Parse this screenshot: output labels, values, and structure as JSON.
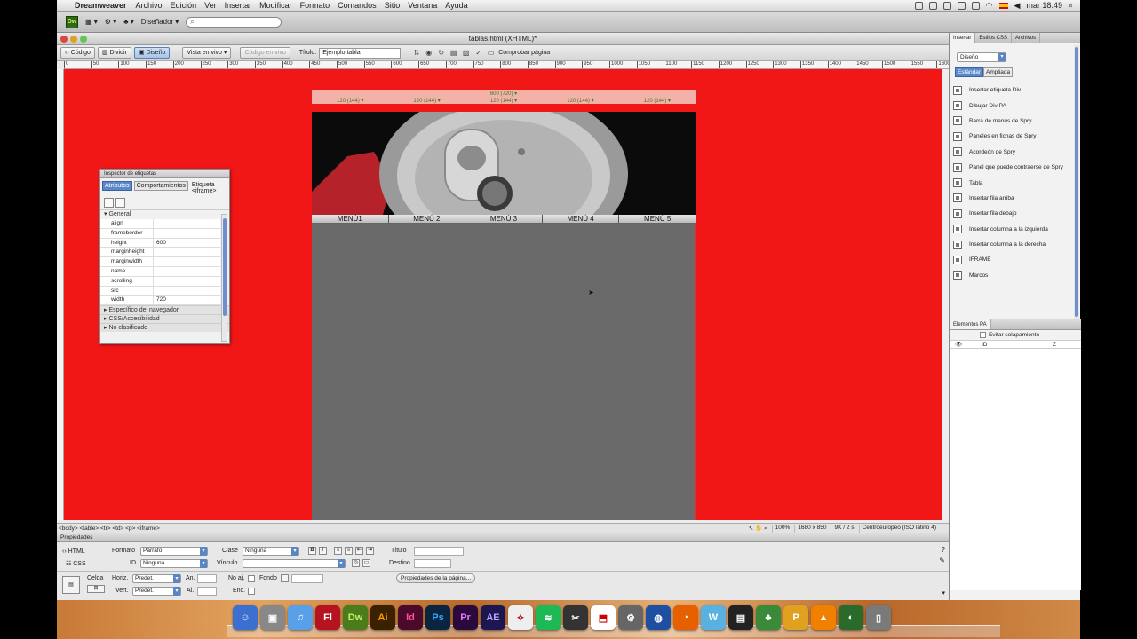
{
  "menubar": {
    "app": "Dreamweaver",
    "items": [
      "Archivo",
      "Edición",
      "Ver",
      "Insertar",
      "Modificar",
      "Formato",
      "Comandos",
      "Sitio",
      "Ventana",
      "Ayuda"
    ],
    "clock": "mar 18:49"
  },
  "appbar": {
    "logo": "Dw",
    "workspace": "Diseñador"
  },
  "document": {
    "window_title": "tablas.html (XHTML)*",
    "view_buttons": [
      "Código",
      "Dividir",
      "Diseño"
    ],
    "live_view": "Vista en vivo",
    "live_code": "Código en vivo",
    "title_label": "Título:",
    "title_value": "Ejemplo tabla",
    "check_page": "Comprobar página"
  },
  "ruler": {
    "ticks": [
      "0",
      "50",
      "100",
      "150",
      "200",
      "250",
      "300",
      "350",
      "400",
      "450",
      "500",
      "550",
      "600",
      "650",
      "700",
      "750",
      "800",
      "850",
      "900",
      "950",
      "1000",
      "1050",
      "1100",
      "1150",
      "1200",
      "1250",
      "1300",
      "1350",
      "1400",
      "1450",
      "1500",
      "1550",
      "1600"
    ]
  },
  "page": {
    "canvas_color": "#f11717",
    "table_width_label": "600 (720) ▾",
    "column_labels": [
      "120 (144) ▾",
      "120 (144) ▾",
      "120 (144) ▾",
      "120 (144) ▾",
      "120 (144) ▾"
    ],
    "menu": [
      "MENÚ1",
      "MENÚ 2",
      "MENÚ 3",
      "MENÚ 4",
      "MENÚ 5"
    ]
  },
  "inspector": {
    "title": "Inspector de etiquetas",
    "tabs": [
      "Atributos",
      "Comportamientos",
      "Etiqueta <iframe>"
    ],
    "section_general": "General",
    "attributes": [
      {
        "k": "align",
        "v": ""
      },
      {
        "k": "frameborder",
        "v": ""
      },
      {
        "k": "height",
        "v": "600"
      },
      {
        "k": "marginheight",
        "v": ""
      },
      {
        "k": "marginwidth",
        "v": ""
      },
      {
        "k": "name",
        "v": ""
      },
      {
        "k": "scrolling",
        "v": ""
      },
      {
        "k": "src",
        "v": ""
      },
      {
        "k": "width",
        "v": "720"
      }
    ],
    "collapsed": [
      "Específico del navegador",
      "CSS/Accesibilidad",
      "No clasificado"
    ]
  },
  "statusbar": {
    "tags": "<body> <table> <tr> <td> <p> <iframe>",
    "zoom": "100%",
    "size": "1680 x 850",
    "weight": "9K / 2 s",
    "encoding": "Centroeuropeo (ISO latino 4)"
  },
  "properties": {
    "title": "Propiedades",
    "html_btn": "HTML",
    "css_btn": "CSS",
    "formato_lbl": "Formato",
    "formato_val": "Párrafo",
    "clase_lbl": "Clase",
    "clase_val": "Ninguna",
    "id_lbl": "ID",
    "id_val": "Ninguna",
    "vinculo_lbl": "Vínculo",
    "titulo_lbl": "Título",
    "destino_lbl": "Destino",
    "celda_lbl": "Celda",
    "horiz_lbl": "Horiz.",
    "horiz_val": "Predet.",
    "vert_lbl": "Vert.",
    "vert_val": "Predet.",
    "an_lbl": "An.",
    "al_lbl": "Al.",
    "noaj_lbl": "No aj.",
    "enc_lbl": "Enc.",
    "fondo_lbl": "Fondo",
    "page_props": "Propiedades de la página..."
  },
  "insert_panel": {
    "tabs": [
      "Insertar",
      "Estilos CSS",
      "Archivos"
    ],
    "category": "Diseño",
    "modes": [
      "Estándar",
      "Ampliada"
    ],
    "items": [
      "Insertar etiqueta Div",
      "Dibujar Div PA",
      "Barra de menús de Spry",
      "Paneles en fichas de Spry",
      "Acordeón de Spry",
      "Panel que puede contraerse de Spry",
      "Tabla",
      "Insertar fila arriba",
      "Insertar fila debajo",
      "Insertar columna a la izquierda",
      "Insertar columna a la derecha",
      "IFRAME",
      "Marcos"
    ]
  },
  "ap_panel": {
    "title": "Elementos PA",
    "option": "Evitar solapamiento",
    "col_id": "ID",
    "col_z": "Z"
  },
  "dock": [
    "Fl",
    "Dw",
    "Ai",
    "Id",
    "Ps",
    "Pr",
    "AE"
  ]
}
